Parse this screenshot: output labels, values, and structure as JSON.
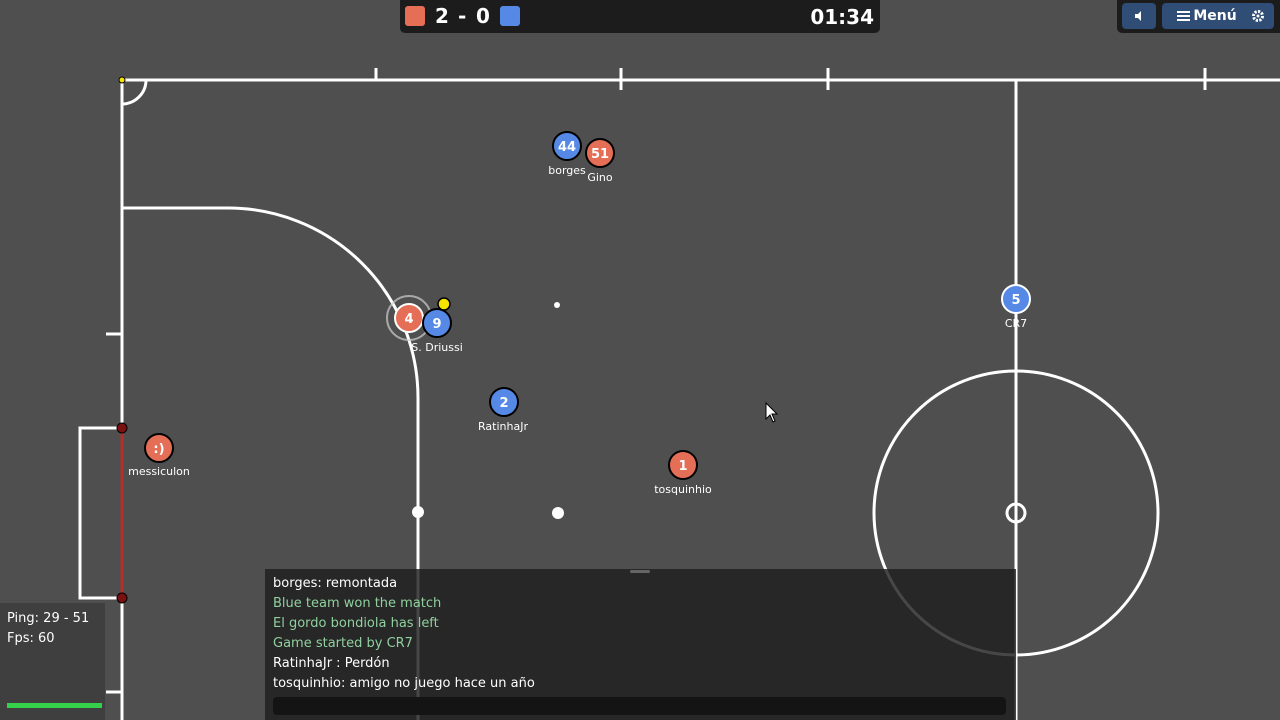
{
  "scoreboard": {
    "red_color": "#e56e56",
    "blue_color": "#5689e5",
    "red_score": "2",
    "separator": "-",
    "blue_score": "0",
    "timer": "01:34"
  },
  "controls": {
    "sound_icon": "speaker-icon",
    "menu_label": "Menú",
    "menu_icon": "hamburger-icon",
    "settings_icon": "gear-icon"
  },
  "players": [
    {
      "avatar": "44",
      "name": "borges",
      "team": "blue"
    },
    {
      "avatar": "51",
      "name": "Gino",
      "team": "red"
    },
    {
      "avatar": "4",
      "name": "",
      "team": "red"
    },
    {
      "avatar": "9",
      "name": "S. Driussi",
      "team": "blue"
    },
    {
      "avatar": "5",
      "name": "CR7",
      "team": "blue"
    },
    {
      "avatar": "2",
      "name": "RatinhaJr",
      "team": "blue"
    },
    {
      "avatar": "1",
      "name": "tosquinhio",
      "team": "red"
    },
    {
      "avatar": ":)",
      "name": "messiculon",
      "team": "red"
    }
  ],
  "stats": {
    "ping": "Ping: 29 - 51",
    "fps": "Fps: 60"
  },
  "chat": {
    "messages": [
      {
        "text": "borges: remontada",
        "type": "player"
      },
      {
        "text": "Blue team won the match",
        "type": "system"
      },
      {
        "text": "El gordo bondiola has left",
        "type": "system"
      },
      {
        "text": "Game started by CR7",
        "type": "system"
      },
      {
        "text": "RatinhaJr : Perdón",
        "type": "player"
      },
      {
        "text": "tosquinhio: amigo no juego hace un año",
        "type": "player"
      }
    ],
    "input_placeholder": ""
  },
  "colors": {
    "pitch": "#4f4f4f",
    "lines": "#ffffff",
    "red_team": "#e56e56",
    "blue_team": "#5689e5",
    "ball": "#ffffff",
    "goal_line": "#c0392b"
  }
}
